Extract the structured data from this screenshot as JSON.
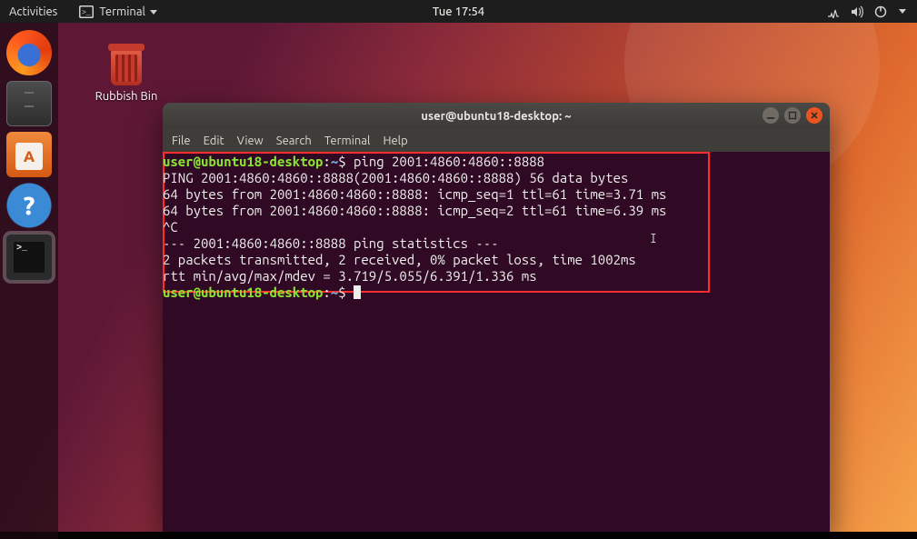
{
  "topbar": {
    "activities": "Activities",
    "app_indicator": "Terminal",
    "clock": "Tue 17:54"
  },
  "dock": {
    "items": [
      {
        "name": "firefox"
      },
      {
        "name": "files"
      },
      {
        "name": "software"
      },
      {
        "name": "help"
      },
      {
        "name": "terminal"
      }
    ]
  },
  "desktop_icons": {
    "trash_label": "Rubbish Bin"
  },
  "terminal_window": {
    "title": "user@ubuntu18-desktop: ~",
    "menus": [
      "File",
      "Edit",
      "View",
      "Search",
      "Terminal",
      "Help"
    ],
    "prompt": {
      "user_host": "user@ubuntu18-desktop",
      "colon": ":",
      "cwd": "~",
      "sigil": "$"
    },
    "command": "ping 2001:4860:4860::8888",
    "output": [
      "PING 2001:4860:4860::8888(2001:4860:4860::8888) 56 data bytes",
      "64 bytes from 2001:4860:4860::8888: icmp_seq=1 ttl=61 time=3.71 ms",
      "64 bytes from 2001:4860:4860::8888: icmp_seq=2 ttl=61 time=6.39 ms",
      "^C",
      "--- 2001:4860:4860::8888 ping statistics ---",
      "2 packets transmitted, 2 received, 0% packet loss, time 1002ms",
      "rtt min/avg/max/mdev = 3.719/5.055/6.391/1.336 ms"
    ]
  }
}
